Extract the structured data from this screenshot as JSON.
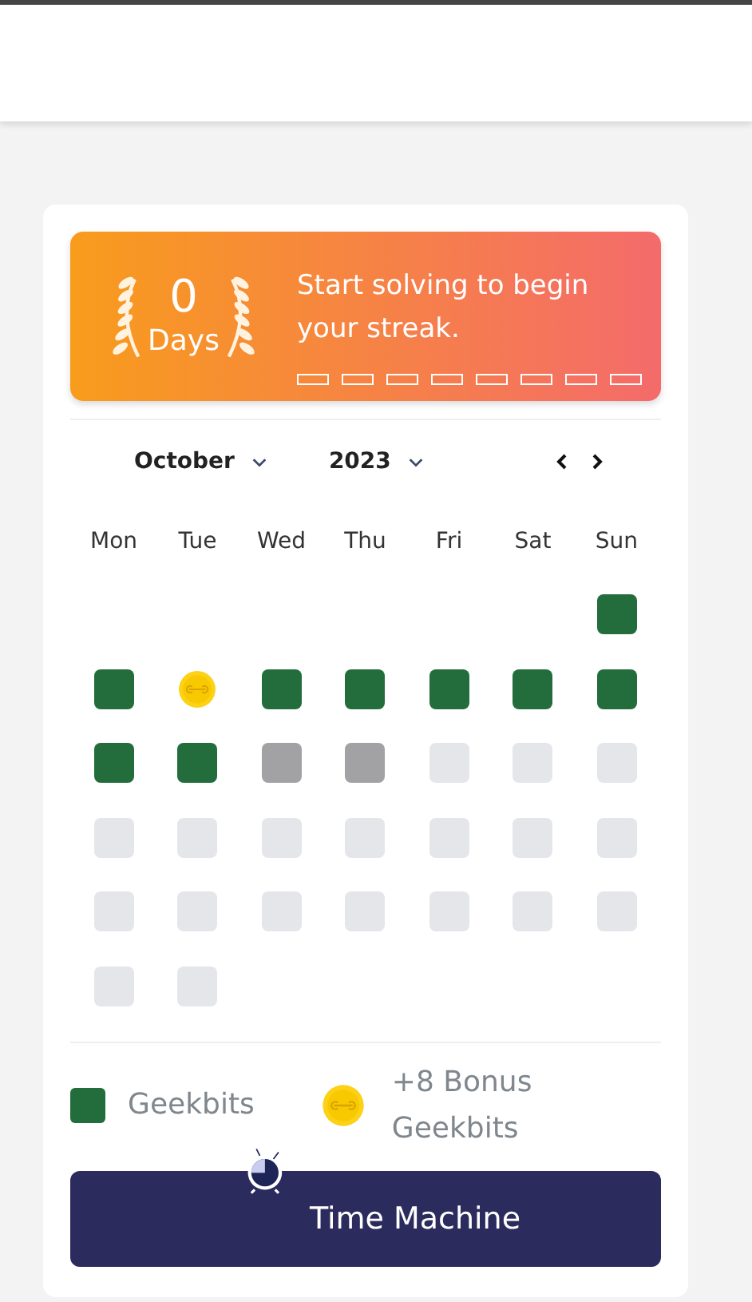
{
  "streak": {
    "count": "0",
    "unit": "Days",
    "message": "Start solving to begin your streak.",
    "slots": [
      {
        "filled": false
      },
      {
        "filled": false
      },
      {
        "filled": false
      },
      {
        "filled": false
      },
      {
        "filled": false
      },
      {
        "filled": false
      },
      {
        "filled": false
      },
      {
        "filled": false
      }
    ]
  },
  "calendar": {
    "month": "October",
    "year": "2023",
    "weekdays": [
      "Mon",
      "Tue",
      "Wed",
      "Thu",
      "Fri",
      "Sat",
      "Sun"
    ],
    "weeks": [
      [
        {
          "kind": "solved"
        }
      ],
      [
        {
          "kind": "solved"
        },
        {
          "kind": "bonus"
        },
        {
          "kind": "solved"
        },
        {
          "kind": "solved"
        },
        {
          "kind": "solved"
        },
        {
          "kind": "solved"
        },
        {
          "kind": "solved"
        }
      ],
      [
        {
          "kind": "solved"
        },
        {
          "kind": "solved"
        },
        {
          "kind": "missed"
        },
        {
          "kind": "missed"
        },
        {
          "kind": "upcoming"
        },
        {
          "kind": "upcoming"
        },
        {
          "kind": "upcoming"
        }
      ],
      [
        {
          "kind": "upcoming"
        },
        {
          "kind": "upcoming"
        },
        {
          "kind": "upcoming"
        },
        {
          "kind": "upcoming"
        },
        {
          "kind": "upcoming"
        },
        {
          "kind": "upcoming"
        },
        {
          "kind": "upcoming"
        }
      ],
      [
        {
          "kind": "upcoming"
        },
        {
          "kind": "upcoming"
        },
        {
          "kind": "upcoming"
        },
        {
          "kind": "upcoming"
        },
        {
          "kind": "upcoming"
        },
        {
          "kind": "upcoming"
        },
        {
          "kind": "upcoming"
        }
      ],
      [
        {
          "kind": "upcoming"
        },
        {
          "kind": "upcoming"
        }
      ]
    ]
  },
  "legend": [
    {
      "kind": "solved",
      "label": "Geekbits"
    },
    {
      "kind": "bonus",
      "label": "+8 Bonus Geekbits"
    }
  ],
  "button": {
    "label": "Time Machine"
  }
}
